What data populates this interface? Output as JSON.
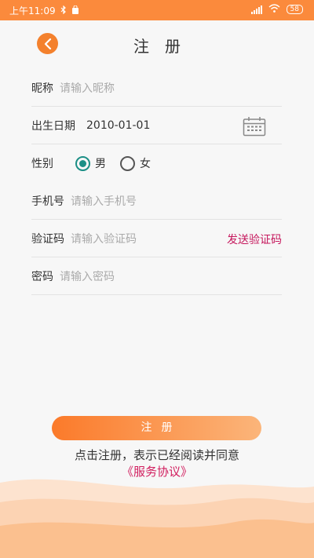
{
  "status_bar": {
    "time": "上午11:09",
    "battery": "58"
  },
  "header": {
    "title": "注册"
  },
  "form": {
    "nickname": {
      "label": "昵称",
      "placeholder": "请输入昵称"
    },
    "birthday": {
      "label": "出生日期",
      "value": "2010-01-01"
    },
    "gender": {
      "label": "性别",
      "options": [
        "男",
        "女"
      ],
      "selected": "男"
    },
    "phone": {
      "label": "手机号",
      "placeholder": "请输入手机号"
    },
    "code": {
      "label": "验证码",
      "placeholder": "请输入验证码",
      "send_label": "发送验证码"
    },
    "password": {
      "label": "密码",
      "placeholder": "请输入密码"
    }
  },
  "submit": {
    "label": "注册"
  },
  "agreement": {
    "text": "点击注册，表示已经阅读并同意",
    "link": "《服务协议》"
  },
  "colors": {
    "brand": "#fb8a3c",
    "radio": "#1c8f86",
    "link": "#c6185d"
  }
}
